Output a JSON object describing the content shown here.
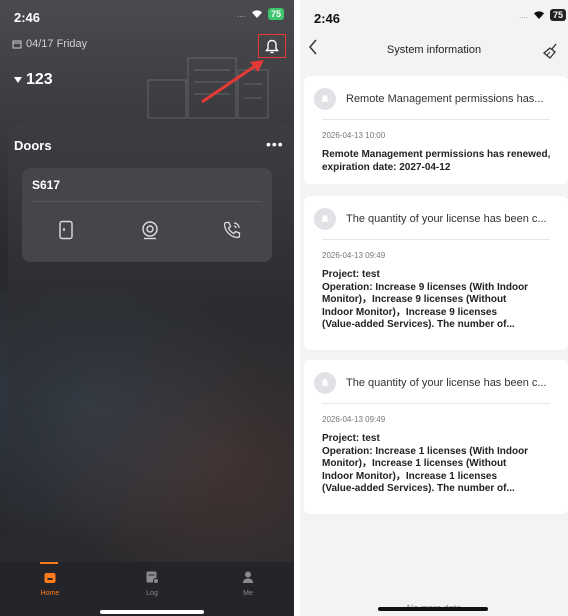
{
  "left_screen": {
    "status_time": "2:46",
    "battery": "75",
    "date": "04/17 Friday",
    "site_name": "123",
    "doors_title": "Doors",
    "more_label": "•••",
    "door": {
      "name": "S617"
    },
    "tabs": [
      {
        "label": "Home",
        "icon": "home-icon",
        "active": true
      },
      {
        "label": "Log",
        "icon": "log-icon",
        "active": false
      },
      {
        "label": "Me",
        "icon": "person-icon",
        "active": false
      }
    ],
    "colors": {
      "accent": "#ff7a1a",
      "highlight": "#e53935",
      "background": "#2a2b2f"
    }
  },
  "right_screen": {
    "status_time": "2:46",
    "battery": "75",
    "title": "System information",
    "messages": [
      {
        "subject": "Remote Management permissions has...",
        "time": "2026-04-13 10:00",
        "body": "Remote Management permissions has renewed, expiration date: 2027-04-12"
      },
      {
        "subject": "The quantity of your license has been c...",
        "time": "2026-04-13 09:49",
        "body_lines": [
          "Project: test",
          "Operation: Increase 9 licenses (With Indoor",
          "Monitor)，Increase 9 licenses (Without",
          "Indoor Monitor)，Increase 9 licenses",
          "(Value-added Services). The number of..."
        ]
      },
      {
        "subject": "The quantity of your license has been c...",
        "time": "2026-04-13 09:49",
        "body_lines": [
          "Project: test",
          "Operation: Increase 1 licenses (With Indoor",
          "Monitor)，Increase 1 licenses (Without",
          "Indoor Monitor)，Increase 1 licenses",
          "(Value-added Services). The number of..."
        ]
      }
    ],
    "footer": "No more data"
  }
}
